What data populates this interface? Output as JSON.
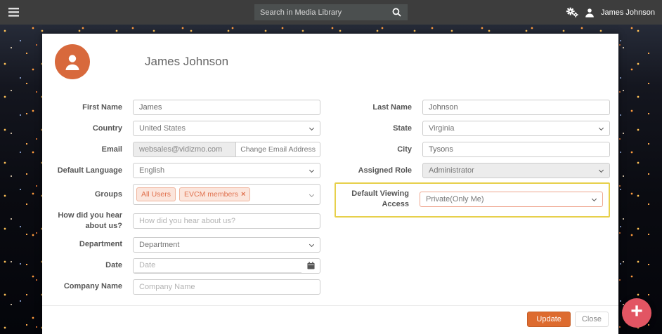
{
  "topbar": {
    "search_placeholder": "Search in Media Library",
    "user_name": "James Johnson"
  },
  "profile": {
    "title": "James Johnson"
  },
  "fields": {
    "first_name": {
      "label": "First Name",
      "value": "James"
    },
    "country": {
      "label": "Country",
      "value": "United States"
    },
    "email": {
      "label": "Email",
      "value": "websales@vidizmo.com",
      "button_label": "Change Email Address"
    },
    "default_language": {
      "label": "Default Language",
      "value": "English"
    },
    "groups": {
      "label": "Groups",
      "tags": [
        {
          "text": "All Users",
          "removable": false
        },
        {
          "text": "EVCM members",
          "removable": true
        }
      ]
    },
    "hear_about": {
      "label": "How did you hear about us?",
      "placeholder": "How did you hear about us?"
    },
    "department": {
      "label": "Department",
      "value": "Department"
    },
    "date": {
      "label": "Date",
      "placeholder": "Date"
    },
    "company_name": {
      "label": "Company Name",
      "placeholder": "Company Name"
    },
    "last_name": {
      "label": "Last Name",
      "value": "Johnson"
    },
    "state": {
      "label": "State",
      "value": "Virginia"
    },
    "city": {
      "label": "City",
      "value": "Tysons"
    },
    "assigned_role": {
      "label": "Assigned Role",
      "value": "Administrator"
    },
    "default_viewing_access": {
      "label": "Default Viewing Access",
      "value": "Private(Only Me)"
    }
  },
  "footer": {
    "update_label": "Update",
    "close_label": "Close"
  },
  "icons": {
    "hamburger-icon": "☰",
    "search-icon": "🔍",
    "cogs-icon": "⚙",
    "user-icon": "👤",
    "chevron-down-icon": "⌄",
    "remove-icon": "×",
    "calendar-icon": "📅",
    "plus-icon": "+"
  },
  "colors": {
    "topbar_bg": "#3d3d3d",
    "avatar_orange": "#d8693c",
    "update_button_orange": "#dd6b2f",
    "highlight_yellow": "#e7d04b",
    "tag_background": "#fbe5dc",
    "tag_text": "#e0714e",
    "fab_red": "#e25563"
  }
}
